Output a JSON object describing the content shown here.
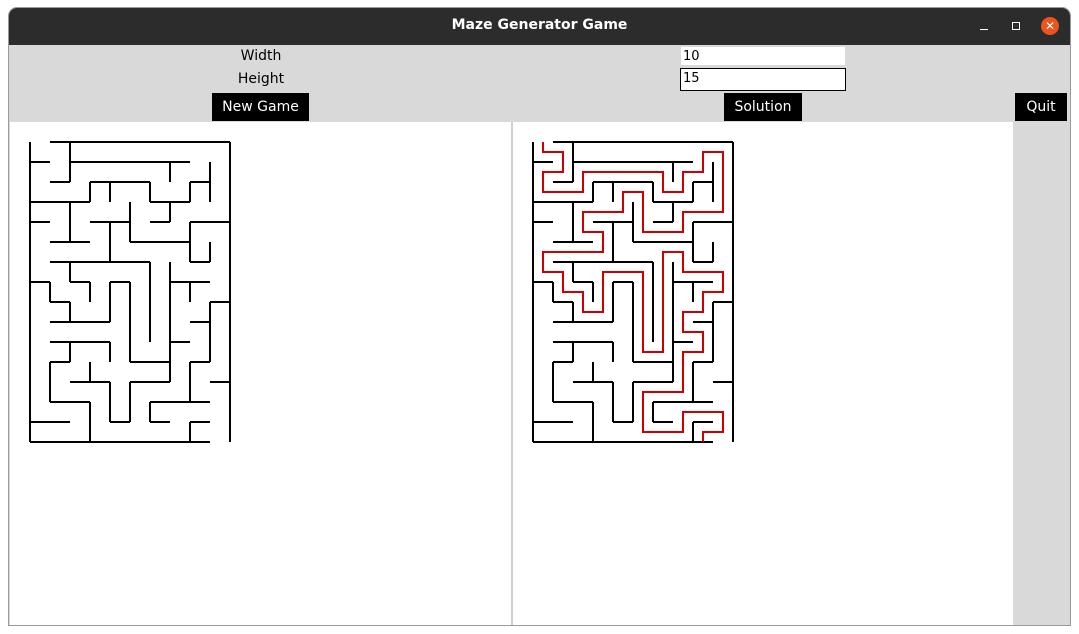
{
  "window": {
    "title": "Maze Generator Game"
  },
  "controls": {
    "width_label": "Width",
    "height_label": "Height",
    "width_value": "10",
    "height_value": "15",
    "new_game_label": "New Game",
    "solution_label": "Solution",
    "quit_label": "Quit"
  },
  "colors": {
    "titlebar": "#2c2c2c",
    "close_button": "#e95420",
    "panel": "#d9d9d9",
    "button": "#000000",
    "maze_wall": "#000000",
    "solution_path": "#cc0000"
  }
}
